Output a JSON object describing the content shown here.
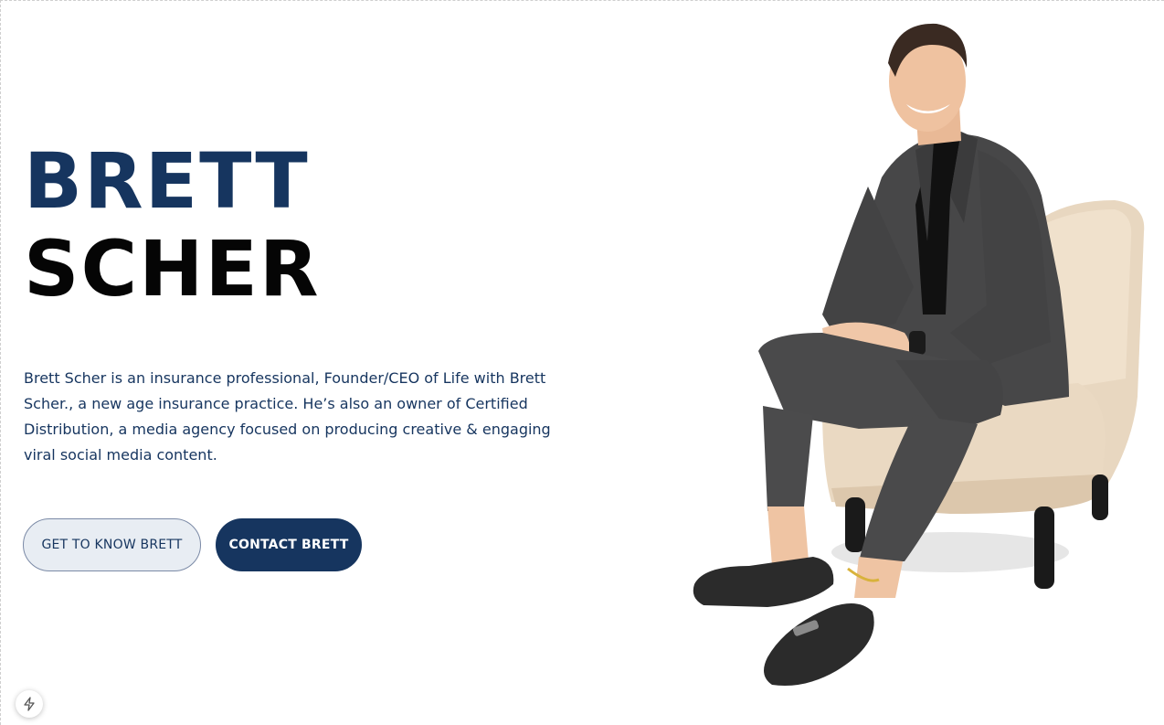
{
  "hero": {
    "first_name": "BRETT",
    "last_name": "SCHER",
    "bio": "Brett Scher is an insurance professional, Founder/CEO of Life with Brett Scher., a new age insurance practice. He’s also an owner of Certified Distribution, a media agency focused on producing creative & engaging viral social media content."
  },
  "buttons": {
    "get_to_know": "GET TO KNOW BRETT",
    "contact": "CONTACT BRETT"
  },
  "colors": {
    "brand_navy": "#16355f",
    "heading_black": "#050505",
    "secondary_button_bg": "#e8edf3"
  },
  "icons": {
    "dev_badge": "lightning-bolt-icon"
  }
}
